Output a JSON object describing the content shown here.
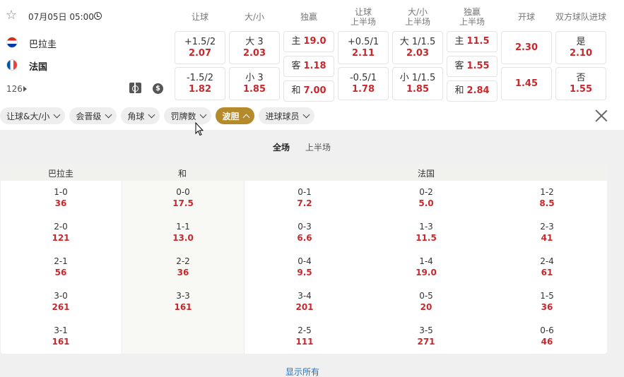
{
  "match": {
    "datetime": "07月05日 05:00",
    "home": "巴拉圭",
    "away": "法国",
    "market_count": "126"
  },
  "headers": {
    "handicap": "让球",
    "over_under": "大/小",
    "moneyline": "独赢",
    "handicap_1h": [
      "让球",
      "上半场"
    ],
    "over_under_1h": [
      "大/小",
      "上半场"
    ],
    "moneyline_1h": [
      "独赢",
      "上半场"
    ],
    "kickoff": "开球",
    "btts": "双方球队进球"
  },
  "odds": {
    "handicap": [
      {
        "label": "+1.5/2",
        "odd": "2.07"
      },
      {
        "label": "-1.5/2",
        "odd": "1.82"
      }
    ],
    "over_under": [
      {
        "label": "大 3",
        "odd": "2.03"
      },
      {
        "label": "小 3",
        "odd": "1.85"
      }
    ],
    "moneyline": [
      {
        "label": "主",
        "odd": "19.0"
      },
      {
        "label": "客",
        "odd": "1.18"
      },
      {
        "label": "和",
        "odd": "7.00"
      }
    ],
    "handicap_1h": [
      {
        "label": "+0.5/1",
        "odd": "2.11"
      },
      {
        "label": "-0.5/1",
        "odd": "1.78"
      }
    ],
    "over_under_1h": [
      {
        "label": "大 1/1.5",
        "odd": "2.03"
      },
      {
        "label": "小 1/1.5",
        "odd": "1.85"
      }
    ],
    "moneyline_1h": [
      {
        "label": "主",
        "odd": "11.5"
      },
      {
        "label": "客",
        "odd": "1.55"
      },
      {
        "label": "和",
        "odd": "2.84"
      }
    ],
    "kickoff": [
      {
        "odd": "2.30"
      },
      {
        "odd": "1.45"
      }
    ],
    "btts": [
      {
        "label": "是",
        "odd": "2.10"
      },
      {
        "label": "否",
        "odd": "1.55"
      }
    ]
  },
  "filters": [
    {
      "label": "让球&大/小",
      "active": false
    },
    {
      "label": "会晋级",
      "active": false
    },
    {
      "label": "角球",
      "active": false
    },
    {
      "label": "罚牌数",
      "active": false
    },
    {
      "label": "波胆",
      "active": true
    },
    {
      "label": "进球球员",
      "active": false
    }
  ],
  "periods": [
    {
      "label": "全场",
      "active": true
    },
    {
      "label": "上半场",
      "active": false
    }
  ],
  "correct_score": {
    "columns": {
      "home": "巴拉圭",
      "draw": "和",
      "away": "法国"
    },
    "home": [
      {
        "score": "1-0",
        "odd": "36"
      },
      {
        "score": "2-0",
        "odd": "121"
      },
      {
        "score": "2-1",
        "odd": "56"
      },
      {
        "score": "3-0",
        "odd": "261"
      },
      {
        "score": "3-1",
        "odd": "161"
      }
    ],
    "draw": [
      {
        "score": "0-0",
        "odd": "17.5"
      },
      {
        "score": "1-1",
        "odd": "13.0"
      },
      {
        "score": "2-2",
        "odd": "36"
      },
      {
        "score": "3-3",
        "odd": "161"
      }
    ],
    "away_col1": [
      {
        "score": "0-1",
        "odd": "7.2"
      },
      {
        "score": "0-3",
        "odd": "6.6"
      },
      {
        "score": "0-4",
        "odd": "9.5"
      },
      {
        "score": "3-4",
        "odd": "201"
      },
      {
        "score": "2-5",
        "odd": "111"
      }
    ],
    "away_col2": [
      {
        "score": "0-2",
        "odd": "5.0"
      },
      {
        "score": "1-3",
        "odd": "11.5"
      },
      {
        "score": "1-4",
        "odd": "19.0"
      },
      {
        "score": "0-5",
        "odd": "20"
      },
      {
        "score": "3-5",
        "odd": "271"
      }
    ],
    "away_col3": [
      {
        "score": "1-2",
        "odd": "8.5"
      },
      {
        "score": "2-3",
        "odd": "41"
      },
      {
        "score": "2-4",
        "odd": "61"
      },
      {
        "score": "1-5",
        "odd": "36"
      },
      {
        "score": "0-6",
        "odd": "46"
      }
    ]
  },
  "show_all": "显示所有"
}
